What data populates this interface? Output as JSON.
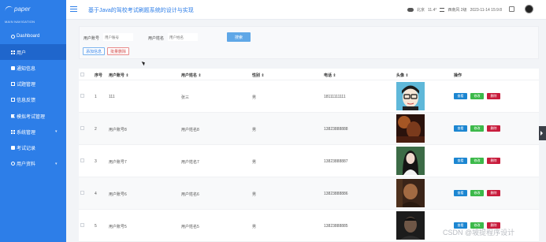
{
  "logo": {
    "text": "paper"
  },
  "sidebar": {
    "header": "MAIN NAVIGATION",
    "items": [
      {
        "label": "Dashboard",
        "icon": "home-icon"
      },
      {
        "label": "用户",
        "icon": "grid-icon",
        "active": true
      },
      {
        "label": "通知信息",
        "icon": "square-icon"
      },
      {
        "label": "试题管理",
        "icon": "doc-icon"
      },
      {
        "label": "信息反馈",
        "icon": "doc-icon"
      },
      {
        "label": "模拟考试管理",
        "icon": "flag-icon"
      },
      {
        "label": "系统管理",
        "icon": "grid-icon",
        "caret": "▾"
      },
      {
        "label": "考试记录",
        "icon": "square-icon"
      },
      {
        "label": "用户资料",
        "icon": "circle-icon",
        "caret": "▾"
      }
    ]
  },
  "header": {
    "title": "基于Java的驾校考试刷题系统的设计与实现",
    "city": "北京",
    "temp": "11.4°",
    "wind": "西南风 2级",
    "datetime": "2023-11-14 15:9:8"
  },
  "filters": {
    "account_label": "用户账号",
    "account_placeholder": "用户账号",
    "name_label": "用户姓名",
    "name_placeholder": "用户姓名",
    "search_label": "搜索",
    "add_label": "添加信息",
    "batch_delete_label": "批量删除"
  },
  "table": {
    "columns": [
      "序号",
      "用户账号 ⇕",
      "用户姓名 ⇕",
      "性别 ⇕",
      "电话 ⇕",
      "头像 ⇕",
      "操作"
    ],
    "actions": {
      "view": "查看",
      "edit": "修改",
      "delete": "删除"
    },
    "rows": [
      {
        "no": "1",
        "account": "111",
        "name": "张三",
        "gender": "男",
        "phone": "18111111111",
        "avatar": "cartoon"
      },
      {
        "no": "2",
        "account": "用户账号8",
        "name": "用户姓名8",
        "gender": "男",
        "phone": "13823888888",
        "avatar": "dark-warm"
      },
      {
        "no": "3",
        "account": "用户账号7",
        "name": "用户姓名7",
        "gender": "男",
        "phone": "13823888887",
        "avatar": "woman"
      },
      {
        "no": "4",
        "account": "用户账号6",
        "name": "用户姓名6",
        "gender": "男",
        "phone": "13823888886",
        "avatar": "dark-brown"
      },
      {
        "no": "5",
        "account": "用户账号5",
        "name": "用户姓名5",
        "gender": "男",
        "phone": "13823888885",
        "avatar": "man"
      }
    ]
  },
  "watermark": "CSDN @坡提程序设计",
  "colors": {
    "primary": "#2d7ee8",
    "view": "#1c86d1",
    "edit": "#3cb94a",
    "delete": "#c81c3c"
  }
}
